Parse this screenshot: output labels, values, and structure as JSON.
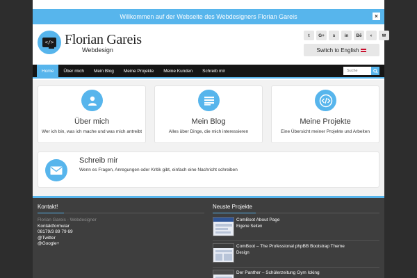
{
  "notice": {
    "text": "Willkommen auf der Webseite des Webdesigners Florian Gareis",
    "close": "×"
  },
  "header": {
    "title": "Florian Gareis",
    "subtitle": "Webdesign",
    "logo_glyph": "</>",
    "social": [
      "twitter-icon",
      "google-plus-icon",
      "skype-icon",
      "linkedin-icon",
      "behance-icon",
      "github-icon",
      "email-icon"
    ],
    "social_glyphs": [
      "t",
      "G+",
      "s",
      "in",
      "Bē",
      "◐",
      "✉"
    ],
    "language_button": "Switch to English"
  },
  "nav": {
    "items": [
      "Home",
      "Über mich",
      "Mein Blog",
      "Meine Projekte",
      "Meine Kunden",
      "Schreib mir"
    ],
    "active_index": 0,
    "search_placeholder": "Suche"
  },
  "cards": [
    {
      "title": "Über mich",
      "text": "Wer ich bin, was ich mache und was mich antreibt",
      "icon": "user-icon"
    },
    {
      "title": "Mein Blog",
      "text": "Alles über Dinge, die mich interessieren",
      "icon": "list-icon"
    },
    {
      "title": "Meine Projekte",
      "text": "Eine Übersicht meiner Projekte und Arbeiten",
      "icon": "code-icon"
    }
  ],
  "contact_card": {
    "title": "Schreib mir",
    "text": "Wenn es Fragen, Anregungen oder Kritik gibt, einfach eine Nachricht schreiben",
    "icon": "envelope-icon"
  },
  "footer": {
    "contact_heading": "Kontakt!",
    "contact_lines": [
      "Florian Gareis - Webdesigner",
      "Kontaktformular",
      "08179/3 89 79 69",
      "@Twitter",
      "@Google+"
    ],
    "projects_heading": "Neuste Projekte",
    "projects": [
      {
        "title": "ComBoot About Page",
        "category": "Eigene Seiten"
      },
      {
        "title": "ComBoot – The Professional phpBB Bootstrap Theme",
        "category": "Design"
      },
      {
        "title": "Der Panther – Schülerzeitung Gym Icking",
        "category": ""
      }
    ]
  },
  "colors": {
    "accent": "#57b5ec",
    "nav_bg": "#151515",
    "footer_bg": "#3e3e3e",
    "page_bg": "#2d2d2d"
  }
}
